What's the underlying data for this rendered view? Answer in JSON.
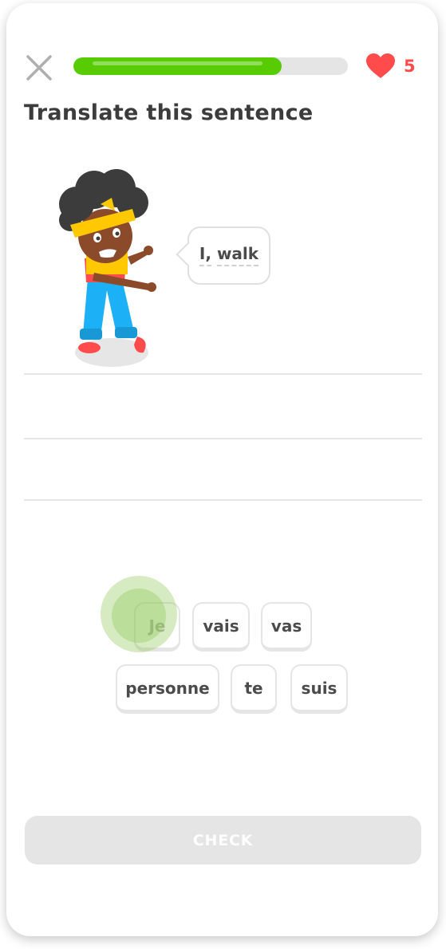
{
  "progress": {
    "value": 0.76
  },
  "hearts": {
    "count": "5",
    "color": "#ff4b4b"
  },
  "lesson": {
    "title": "Translate this sentence",
    "speech_bubble": {
      "words": [
        "I,",
        "walk"
      ]
    }
  },
  "word_bank": {
    "tiles": [
      "Je",
      "vais",
      "vas",
      "personne",
      "te",
      "suis"
    ]
  },
  "check_button": {
    "label": "CHECK"
  },
  "colors": {
    "accent": "#58cc02",
    "track": "#e5e5e5",
    "heart": "#ff4b4b"
  }
}
